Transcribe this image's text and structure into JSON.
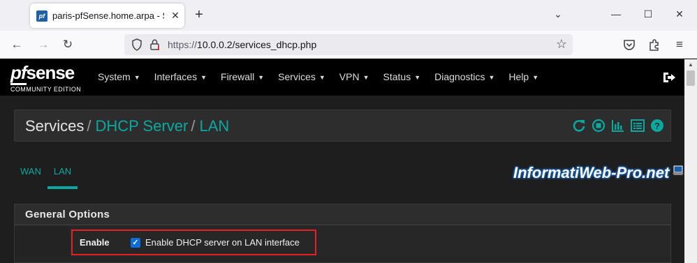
{
  "browser": {
    "tab_title": "paris-pfSense.home.arpa - Serv",
    "favicon_text": "pf",
    "url_proto": "https://",
    "url_host_path": "10.0.0.2/services_dhcp.php"
  },
  "header": {
    "logo_pf": "pf",
    "logo_sense": "sense",
    "logo_sub": "COMMUNITY EDITION",
    "menu": [
      {
        "label": "System"
      },
      {
        "label": "Interfaces"
      },
      {
        "label": "Firewall"
      },
      {
        "label": "Services"
      },
      {
        "label": "VPN"
      },
      {
        "label": "Status"
      },
      {
        "label": "Diagnostics"
      },
      {
        "label": "Help"
      }
    ]
  },
  "breadcrumb": {
    "first": "Services",
    "second": "DHCP Server",
    "third": "LAN",
    "sep": "/"
  },
  "tabs": [
    {
      "label": "WAN",
      "active": false
    },
    {
      "label": "LAN",
      "active": true
    }
  ],
  "general": {
    "title": "General Options",
    "enable_label": "Enable",
    "enable_checkbox_text": "Enable DHCP server on LAN interface",
    "enable_checked": true
  },
  "watermark": {
    "text": "InformatiWeb-Pro.net"
  },
  "colors": {
    "accent": "#0aa9a0",
    "highlight": "#e12323",
    "checkbox": "#0b6dd9"
  }
}
